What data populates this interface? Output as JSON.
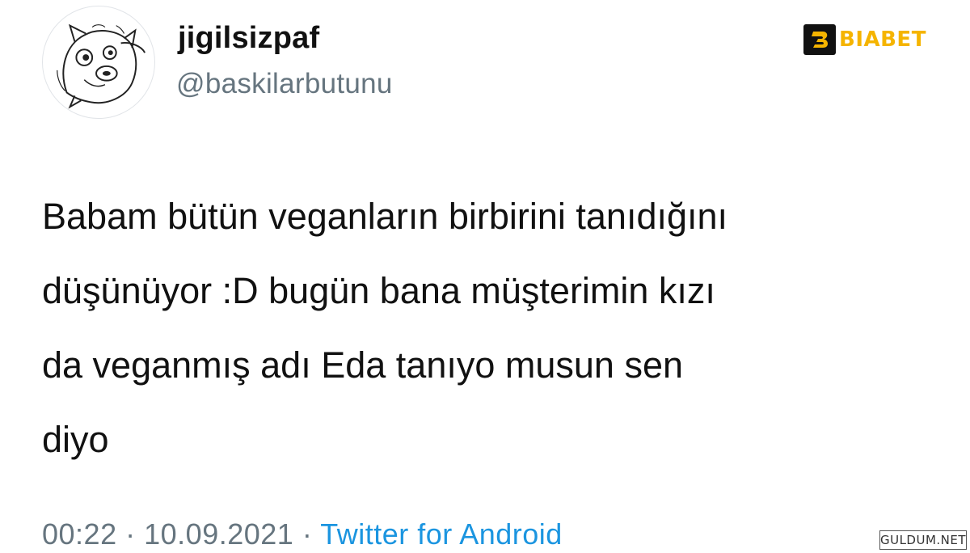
{
  "user": {
    "display_name": "jigilsizpaf",
    "handle": "@baskilarbutunu",
    "avatar_icon": "cartoon-cat-avatar-icon"
  },
  "tweet": {
    "lines": [
      "Babam bütün veganların birbirini tanıdığını",
      "düşünüyor :D bugün bana müşterimin kızı",
      "da veganmış adı Eda tanıyo musun sen",
      "diyo"
    ]
  },
  "meta": {
    "time": "00:22",
    "separator": "·",
    "date": "10.09.2021",
    "source": "Twitter for Android"
  },
  "brand": {
    "text": "BIABET",
    "color": "#f5b400",
    "icon": "biabet-logo-icon"
  },
  "watermark": {
    "text": "GULDUM.NET"
  },
  "colors": {
    "text": "#111111",
    "secondary": "#66757f",
    "link": "#1b95e0"
  }
}
